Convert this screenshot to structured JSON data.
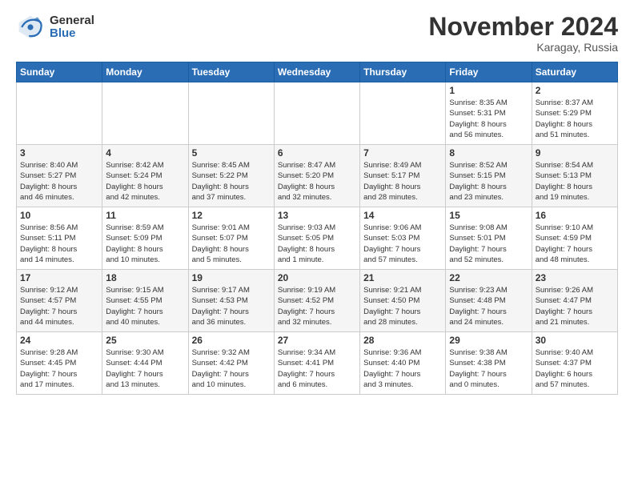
{
  "logo": {
    "general": "General",
    "blue": "Blue"
  },
  "title": "November 2024",
  "location": "Karagay, Russia",
  "weekdays": [
    "Sunday",
    "Monday",
    "Tuesday",
    "Wednesday",
    "Thursday",
    "Friday",
    "Saturday"
  ],
  "weeks": [
    [
      {
        "day": "",
        "info": ""
      },
      {
        "day": "",
        "info": ""
      },
      {
        "day": "",
        "info": ""
      },
      {
        "day": "",
        "info": ""
      },
      {
        "day": "",
        "info": ""
      },
      {
        "day": "1",
        "info": "Sunrise: 8:35 AM\nSunset: 5:31 PM\nDaylight: 8 hours\nand 56 minutes."
      },
      {
        "day": "2",
        "info": "Sunrise: 8:37 AM\nSunset: 5:29 PM\nDaylight: 8 hours\nand 51 minutes."
      }
    ],
    [
      {
        "day": "3",
        "info": "Sunrise: 8:40 AM\nSunset: 5:27 PM\nDaylight: 8 hours\nand 46 minutes."
      },
      {
        "day": "4",
        "info": "Sunrise: 8:42 AM\nSunset: 5:24 PM\nDaylight: 8 hours\nand 42 minutes."
      },
      {
        "day": "5",
        "info": "Sunrise: 8:45 AM\nSunset: 5:22 PM\nDaylight: 8 hours\nand 37 minutes."
      },
      {
        "day": "6",
        "info": "Sunrise: 8:47 AM\nSunset: 5:20 PM\nDaylight: 8 hours\nand 32 minutes."
      },
      {
        "day": "7",
        "info": "Sunrise: 8:49 AM\nSunset: 5:17 PM\nDaylight: 8 hours\nand 28 minutes."
      },
      {
        "day": "8",
        "info": "Sunrise: 8:52 AM\nSunset: 5:15 PM\nDaylight: 8 hours\nand 23 minutes."
      },
      {
        "day": "9",
        "info": "Sunrise: 8:54 AM\nSunset: 5:13 PM\nDaylight: 8 hours\nand 19 minutes."
      }
    ],
    [
      {
        "day": "10",
        "info": "Sunrise: 8:56 AM\nSunset: 5:11 PM\nDaylight: 8 hours\nand 14 minutes."
      },
      {
        "day": "11",
        "info": "Sunrise: 8:59 AM\nSunset: 5:09 PM\nDaylight: 8 hours\nand 10 minutes."
      },
      {
        "day": "12",
        "info": "Sunrise: 9:01 AM\nSunset: 5:07 PM\nDaylight: 8 hours\nand 5 minutes."
      },
      {
        "day": "13",
        "info": "Sunrise: 9:03 AM\nSunset: 5:05 PM\nDaylight: 8 hours\nand 1 minute."
      },
      {
        "day": "14",
        "info": "Sunrise: 9:06 AM\nSunset: 5:03 PM\nDaylight: 7 hours\nand 57 minutes."
      },
      {
        "day": "15",
        "info": "Sunrise: 9:08 AM\nSunset: 5:01 PM\nDaylight: 7 hours\nand 52 minutes."
      },
      {
        "day": "16",
        "info": "Sunrise: 9:10 AM\nSunset: 4:59 PM\nDaylight: 7 hours\nand 48 minutes."
      }
    ],
    [
      {
        "day": "17",
        "info": "Sunrise: 9:12 AM\nSunset: 4:57 PM\nDaylight: 7 hours\nand 44 minutes."
      },
      {
        "day": "18",
        "info": "Sunrise: 9:15 AM\nSunset: 4:55 PM\nDaylight: 7 hours\nand 40 minutes."
      },
      {
        "day": "19",
        "info": "Sunrise: 9:17 AM\nSunset: 4:53 PM\nDaylight: 7 hours\nand 36 minutes."
      },
      {
        "day": "20",
        "info": "Sunrise: 9:19 AM\nSunset: 4:52 PM\nDaylight: 7 hours\nand 32 minutes."
      },
      {
        "day": "21",
        "info": "Sunrise: 9:21 AM\nSunset: 4:50 PM\nDaylight: 7 hours\nand 28 minutes."
      },
      {
        "day": "22",
        "info": "Sunrise: 9:23 AM\nSunset: 4:48 PM\nDaylight: 7 hours\nand 24 minutes."
      },
      {
        "day": "23",
        "info": "Sunrise: 9:26 AM\nSunset: 4:47 PM\nDaylight: 7 hours\nand 21 minutes."
      }
    ],
    [
      {
        "day": "24",
        "info": "Sunrise: 9:28 AM\nSunset: 4:45 PM\nDaylight: 7 hours\nand 17 minutes."
      },
      {
        "day": "25",
        "info": "Sunrise: 9:30 AM\nSunset: 4:44 PM\nDaylight: 7 hours\nand 13 minutes."
      },
      {
        "day": "26",
        "info": "Sunrise: 9:32 AM\nSunset: 4:42 PM\nDaylight: 7 hours\nand 10 minutes."
      },
      {
        "day": "27",
        "info": "Sunrise: 9:34 AM\nSunset: 4:41 PM\nDaylight: 7 hours\nand 6 minutes."
      },
      {
        "day": "28",
        "info": "Sunrise: 9:36 AM\nSunset: 4:40 PM\nDaylight: 7 hours\nand 3 minutes."
      },
      {
        "day": "29",
        "info": "Sunrise: 9:38 AM\nSunset: 4:38 PM\nDaylight: 7 hours\nand 0 minutes."
      },
      {
        "day": "30",
        "info": "Sunrise: 9:40 AM\nSunset: 4:37 PM\nDaylight: 6 hours\nand 57 minutes."
      }
    ]
  ]
}
